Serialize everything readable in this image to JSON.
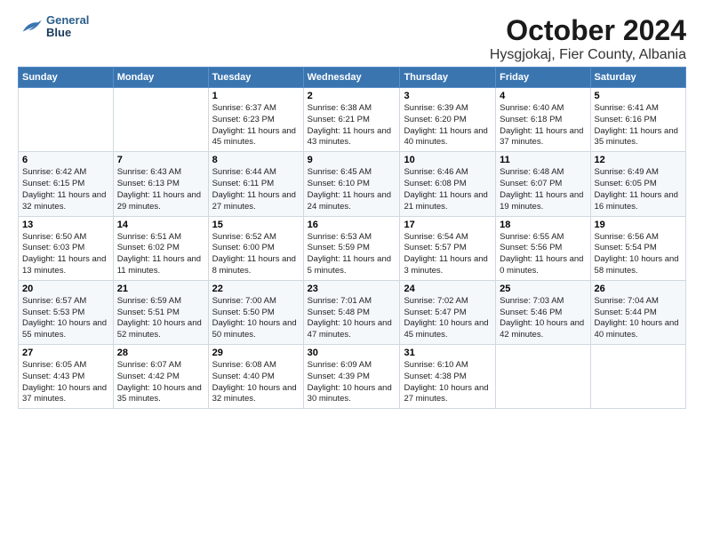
{
  "logo": {
    "line1": "General",
    "line2": "Blue"
  },
  "title": "October 2024",
  "subtitle": "Hysgjokaj, Fier County, Albania",
  "days_of_week": [
    "Sunday",
    "Monday",
    "Tuesday",
    "Wednesday",
    "Thursday",
    "Friday",
    "Saturday"
  ],
  "weeks": [
    [
      {
        "num": "",
        "info": ""
      },
      {
        "num": "",
        "info": ""
      },
      {
        "num": "1",
        "info": "Sunrise: 6:37 AM\nSunset: 6:23 PM\nDaylight: 11 hours and 45 minutes."
      },
      {
        "num": "2",
        "info": "Sunrise: 6:38 AM\nSunset: 6:21 PM\nDaylight: 11 hours and 43 minutes."
      },
      {
        "num": "3",
        "info": "Sunrise: 6:39 AM\nSunset: 6:20 PM\nDaylight: 11 hours and 40 minutes."
      },
      {
        "num": "4",
        "info": "Sunrise: 6:40 AM\nSunset: 6:18 PM\nDaylight: 11 hours and 37 minutes."
      },
      {
        "num": "5",
        "info": "Sunrise: 6:41 AM\nSunset: 6:16 PM\nDaylight: 11 hours and 35 minutes."
      }
    ],
    [
      {
        "num": "6",
        "info": "Sunrise: 6:42 AM\nSunset: 6:15 PM\nDaylight: 11 hours and 32 minutes."
      },
      {
        "num": "7",
        "info": "Sunrise: 6:43 AM\nSunset: 6:13 PM\nDaylight: 11 hours and 29 minutes."
      },
      {
        "num": "8",
        "info": "Sunrise: 6:44 AM\nSunset: 6:11 PM\nDaylight: 11 hours and 27 minutes."
      },
      {
        "num": "9",
        "info": "Sunrise: 6:45 AM\nSunset: 6:10 PM\nDaylight: 11 hours and 24 minutes."
      },
      {
        "num": "10",
        "info": "Sunrise: 6:46 AM\nSunset: 6:08 PM\nDaylight: 11 hours and 21 minutes."
      },
      {
        "num": "11",
        "info": "Sunrise: 6:48 AM\nSunset: 6:07 PM\nDaylight: 11 hours and 19 minutes."
      },
      {
        "num": "12",
        "info": "Sunrise: 6:49 AM\nSunset: 6:05 PM\nDaylight: 11 hours and 16 minutes."
      }
    ],
    [
      {
        "num": "13",
        "info": "Sunrise: 6:50 AM\nSunset: 6:03 PM\nDaylight: 11 hours and 13 minutes."
      },
      {
        "num": "14",
        "info": "Sunrise: 6:51 AM\nSunset: 6:02 PM\nDaylight: 11 hours and 11 minutes."
      },
      {
        "num": "15",
        "info": "Sunrise: 6:52 AM\nSunset: 6:00 PM\nDaylight: 11 hours and 8 minutes."
      },
      {
        "num": "16",
        "info": "Sunrise: 6:53 AM\nSunset: 5:59 PM\nDaylight: 11 hours and 5 minutes."
      },
      {
        "num": "17",
        "info": "Sunrise: 6:54 AM\nSunset: 5:57 PM\nDaylight: 11 hours and 3 minutes."
      },
      {
        "num": "18",
        "info": "Sunrise: 6:55 AM\nSunset: 5:56 PM\nDaylight: 11 hours and 0 minutes."
      },
      {
        "num": "19",
        "info": "Sunrise: 6:56 AM\nSunset: 5:54 PM\nDaylight: 10 hours and 58 minutes."
      }
    ],
    [
      {
        "num": "20",
        "info": "Sunrise: 6:57 AM\nSunset: 5:53 PM\nDaylight: 10 hours and 55 minutes."
      },
      {
        "num": "21",
        "info": "Sunrise: 6:59 AM\nSunset: 5:51 PM\nDaylight: 10 hours and 52 minutes."
      },
      {
        "num": "22",
        "info": "Sunrise: 7:00 AM\nSunset: 5:50 PM\nDaylight: 10 hours and 50 minutes."
      },
      {
        "num": "23",
        "info": "Sunrise: 7:01 AM\nSunset: 5:48 PM\nDaylight: 10 hours and 47 minutes."
      },
      {
        "num": "24",
        "info": "Sunrise: 7:02 AM\nSunset: 5:47 PM\nDaylight: 10 hours and 45 minutes."
      },
      {
        "num": "25",
        "info": "Sunrise: 7:03 AM\nSunset: 5:46 PM\nDaylight: 10 hours and 42 minutes."
      },
      {
        "num": "26",
        "info": "Sunrise: 7:04 AM\nSunset: 5:44 PM\nDaylight: 10 hours and 40 minutes."
      }
    ],
    [
      {
        "num": "27",
        "info": "Sunrise: 6:05 AM\nSunset: 4:43 PM\nDaylight: 10 hours and 37 minutes."
      },
      {
        "num": "28",
        "info": "Sunrise: 6:07 AM\nSunset: 4:42 PM\nDaylight: 10 hours and 35 minutes."
      },
      {
        "num": "29",
        "info": "Sunrise: 6:08 AM\nSunset: 4:40 PM\nDaylight: 10 hours and 32 minutes."
      },
      {
        "num": "30",
        "info": "Sunrise: 6:09 AM\nSunset: 4:39 PM\nDaylight: 10 hours and 30 minutes."
      },
      {
        "num": "31",
        "info": "Sunrise: 6:10 AM\nSunset: 4:38 PM\nDaylight: 10 hours and 27 minutes."
      },
      {
        "num": "",
        "info": ""
      },
      {
        "num": "",
        "info": ""
      }
    ]
  ]
}
